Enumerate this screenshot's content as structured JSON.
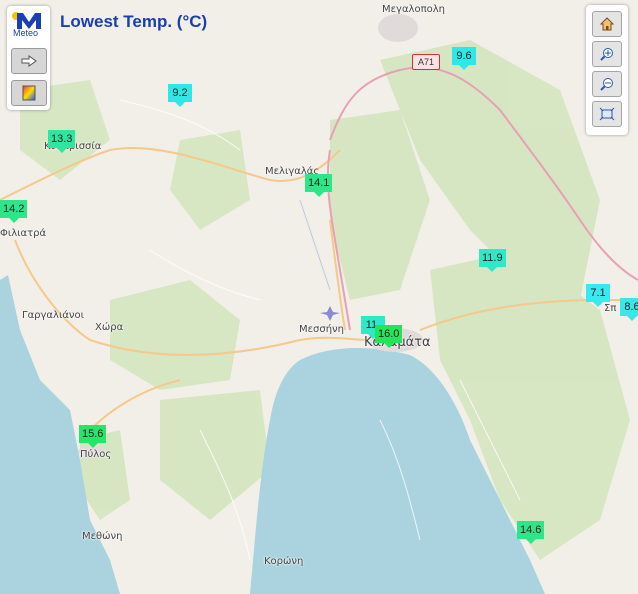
{
  "title": "Lowest Temp. (°C)",
  "logo": {
    "text": "Meteo",
    "icon": "meteo-logo-icon"
  },
  "left_buttons": [
    {
      "icon": "arrow-right-icon"
    },
    {
      "icon": "color-scale-icon"
    }
  ],
  "right_buttons": [
    {
      "icon": "home-icon"
    },
    {
      "icon": "zoom-in-icon"
    },
    {
      "icon": "zoom-out-icon"
    },
    {
      "icon": "fit-extent-icon"
    }
  ],
  "road_shield": "A71",
  "places": [
    "Μεγαλοπολη",
    "Μελιγαλάς",
    "Μεσσήνη",
    "Καλαμάτα",
    "Γαργαλιάνοι",
    "Χώρα",
    "Πύλος",
    "Μεθώνη",
    "Κορώνη",
    "Κυπαρισσία",
    "Φιλιατρά",
    "Σπ"
  ],
  "markers": [
    {
      "value": "13.3",
      "color": "#2ee6a0"
    },
    {
      "value": "9.2",
      "color": "#2ee8e8"
    },
    {
      "value": "9.6",
      "color": "#2ee8e8"
    },
    {
      "value": "14.1",
      "color": "#2ee68a"
    },
    {
      "value": "14.2",
      "color": "#2ee68a"
    },
    {
      "value": "11.9",
      "color": "#2ee8c8"
    },
    {
      "value": "7.1",
      "color": "#3ae8f0"
    },
    {
      "value": "8.6",
      "color": "#38e8e8"
    },
    {
      "value": "11.",
      "color": "#2ee8c8"
    },
    {
      "value": "16.0",
      "color": "#22e65a"
    },
    {
      "value": "15.6",
      "color": "#26e66a"
    },
    {
      "value": "14.6",
      "color": "#2ee68a"
    }
  ]
}
